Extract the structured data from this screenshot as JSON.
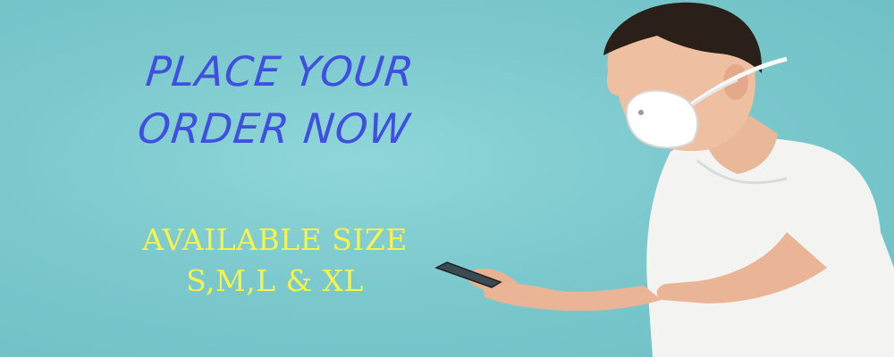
{
  "banner": {
    "headline_line1": "PLACE YOUR",
    "headline_line2": "ORDER NOW",
    "sizes_line1": "AVAILABLE SIZE",
    "sizes_line2": "S,M,L & XL"
  },
  "colors": {
    "background": "#7cc9cd",
    "headline": "#3f50e0",
    "sizes": "#f6f34a"
  },
  "image": {
    "subject": "man-wearing-face-mask-holding-phone"
  }
}
